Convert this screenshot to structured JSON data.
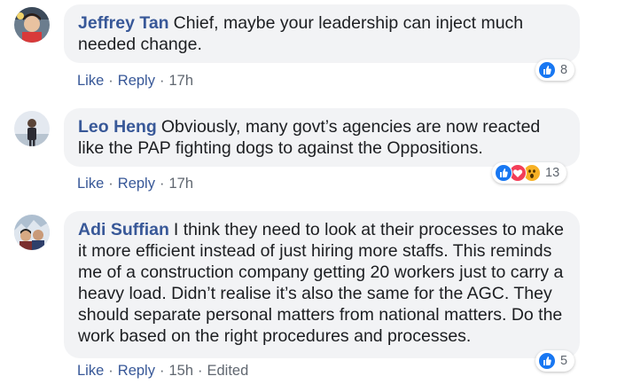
{
  "comments": [
    {
      "author": "Jeffrey Tan",
      "text": "Chief, maybe your leadership can inject much needed change.",
      "reaction_count": "8",
      "reactions": [
        "like"
      ],
      "like_label": "Like",
      "reply_label": "Reply",
      "time": "17h"
    },
    {
      "author": "Leo Heng",
      "text": "Obviously, many govt’s agencies are now reacted like the PAP fighting dogs to against the Oppositions.",
      "reaction_count": "13",
      "reactions": [
        "like",
        "love",
        "wow"
      ],
      "like_label": "Like",
      "reply_label": "Reply",
      "time": "17h"
    },
    {
      "author": "Adi Suffian",
      "text": "I think they need to look at their processes to make it more efficient instead of just hiring more staffs. This reminds me of a construction company getting 20 workers just to carry a heavy load. Didn’t realise it’s also the same for the AGC. They should separate personal matters from national matters. Do the work based on the right procedures and processes.",
      "reaction_count": "5",
      "reactions": [
        "like"
      ],
      "like_label": "Like",
      "reply_label": "Reply",
      "time": "15h",
      "edited_label": "Edited"
    }
  ],
  "colors": {
    "author": "#385898",
    "bubble": "#f2f3f5",
    "like": "#1877f2",
    "love": "#f33e58",
    "wow": "#f7b125"
  }
}
